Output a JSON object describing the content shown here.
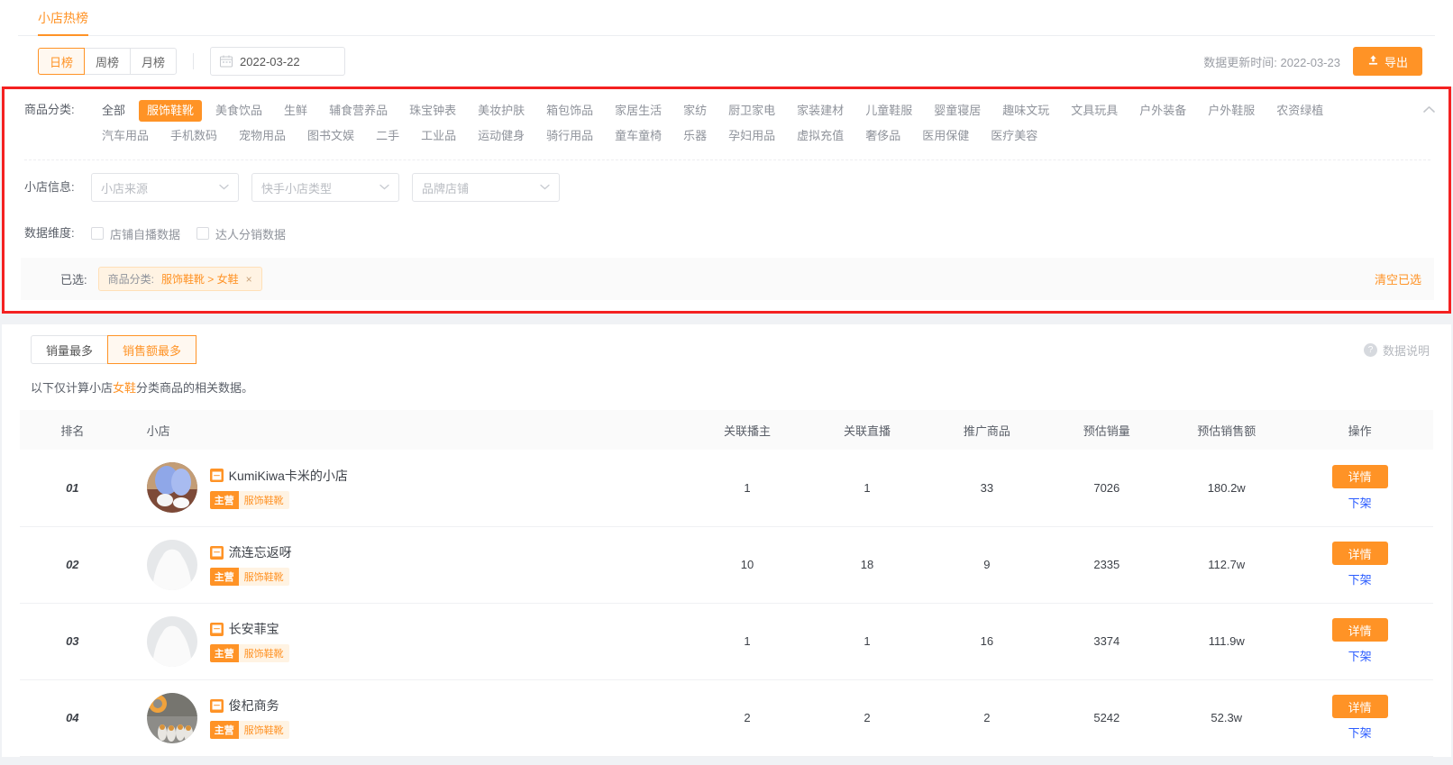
{
  "header": {
    "page_title": "小店热榜",
    "period_tabs": [
      {
        "label": "日榜",
        "active": true
      },
      {
        "label": "周榜",
        "active": false
      },
      {
        "label": "月榜",
        "active": false
      }
    ],
    "date_value": "2022-03-22",
    "calendar_icon": "calendar-icon",
    "update_time": "数据更新时间: 2022-03-23",
    "export_label": "导出",
    "export_icon": "upload-icon"
  },
  "filters": {
    "category": {
      "label": "商品分类:",
      "items": [
        {
          "label": "全部",
          "selected": false,
          "all": true
        },
        {
          "label": "服饰鞋靴",
          "selected": true
        },
        {
          "label": "美食饮品",
          "selected": false
        },
        {
          "label": "生鲜",
          "selected": false
        },
        {
          "label": "辅食营养品",
          "selected": false
        },
        {
          "label": "珠宝钟表",
          "selected": false
        },
        {
          "label": "美妆护肤",
          "selected": false
        },
        {
          "label": "箱包饰品",
          "selected": false
        },
        {
          "label": "家居生活",
          "selected": false
        },
        {
          "label": "家纺",
          "selected": false
        },
        {
          "label": "厨卫家电",
          "selected": false
        },
        {
          "label": "家装建材",
          "selected": false
        },
        {
          "label": "儿童鞋服",
          "selected": false
        },
        {
          "label": "婴童寝居",
          "selected": false
        },
        {
          "label": "趣味文玩",
          "selected": false
        },
        {
          "label": "文具玩具",
          "selected": false
        },
        {
          "label": "户外装备",
          "selected": false
        },
        {
          "label": "户外鞋服",
          "selected": false
        },
        {
          "label": "农资绿植",
          "selected": false
        },
        {
          "label": "汽车用品",
          "selected": false
        },
        {
          "label": "手机数码",
          "selected": false
        },
        {
          "label": "宠物用品",
          "selected": false
        },
        {
          "label": "图书文娱",
          "selected": false
        },
        {
          "label": "二手",
          "selected": false
        },
        {
          "label": "工业品",
          "selected": false
        },
        {
          "label": "运动健身",
          "selected": false
        },
        {
          "label": "骑行用品",
          "selected": false
        },
        {
          "label": "童车童椅",
          "selected": false
        },
        {
          "label": "乐器",
          "selected": false
        },
        {
          "label": "孕妇用品",
          "selected": false
        },
        {
          "label": "虚拟充值",
          "selected": false
        },
        {
          "label": "奢侈品",
          "selected": false
        },
        {
          "label": "医用保健",
          "selected": false
        },
        {
          "label": "医疗美容",
          "selected": false
        }
      ],
      "collapse_icon": "chevron-up-icon"
    },
    "shop_info": {
      "label": "小店信息:",
      "selects": [
        {
          "placeholder": "小店来源"
        },
        {
          "placeholder": "快手小店类型"
        },
        {
          "placeholder": "品牌店铺"
        }
      ]
    },
    "data_dimension": {
      "label": "数据维度:",
      "checkboxes": [
        {
          "label": "店铺自播数据",
          "checked": false
        },
        {
          "label": "达人分销数据",
          "checked": false
        }
      ]
    },
    "selected": {
      "label": "已选:",
      "tag_key": "商品分类:",
      "tag_value": "服饰鞋靴 > 女鞋",
      "tag_close": "×",
      "clear_all": "清空已选"
    }
  },
  "results": {
    "rank_tabs": [
      {
        "label": "销量最多",
        "active": false
      },
      {
        "label": "销售额最多",
        "active": true
      }
    ],
    "data_note_label": "数据说明",
    "data_note_icon": "question-circle-icon",
    "note_prefix": "以下仅计算小店",
    "note_highlight": "女鞋",
    "note_suffix": "分类商品的相关数据。",
    "columns": [
      "排名",
      "小店",
      "关联播主",
      "关联直播",
      "推广商品",
      "预估销量",
      "预估销售额",
      "操作"
    ],
    "rows": [
      {
        "rank": "01",
        "shop_name": "KumiKiwa卡米的小店",
        "shop_icon": "shop-badge-icon",
        "tag_key": "主营",
        "tag_val": "服饰鞋靴",
        "avatar_type": "photo",
        "anchors": "1",
        "lives": "1",
        "products": "33",
        "est_sales": "7026",
        "est_amount": "180.2w",
        "detail_label": "详情",
        "offshelf_label": "下架"
      },
      {
        "rank": "02",
        "shop_name": "流连忘返呀",
        "shop_icon": "shop-badge-icon",
        "tag_key": "主营",
        "tag_val": "服饰鞋靴",
        "avatar_type": "placeholder",
        "anchors": "10",
        "lives": "18",
        "products": "9",
        "est_sales": "2335",
        "est_amount": "112.7w",
        "detail_label": "详情",
        "offshelf_label": "下架"
      },
      {
        "rank": "03",
        "shop_name": "长安菲宝",
        "shop_icon": "shop-badge-icon",
        "tag_key": "主营",
        "tag_val": "服饰鞋靴",
        "avatar_type": "placeholder",
        "anchors": "1",
        "lives": "1",
        "products": "16",
        "est_sales": "3374",
        "est_amount": "111.9w",
        "detail_label": "详情",
        "offshelf_label": "下架"
      },
      {
        "rank": "04",
        "shop_name": "俊杞商务",
        "shop_icon": "shop-badge-icon",
        "tag_key": "主营",
        "tag_val": "服饰鞋靴",
        "avatar_type": "photo2",
        "anchors": "2",
        "lives": "2",
        "products": "2",
        "est_sales": "5242",
        "est_amount": "52.3w",
        "detail_label": "详情",
        "offshelf_label": "下架"
      }
    ]
  },
  "colors": {
    "accent": "#ff9326",
    "highlight_border": "#f42121",
    "link": "#2b5cff"
  }
}
